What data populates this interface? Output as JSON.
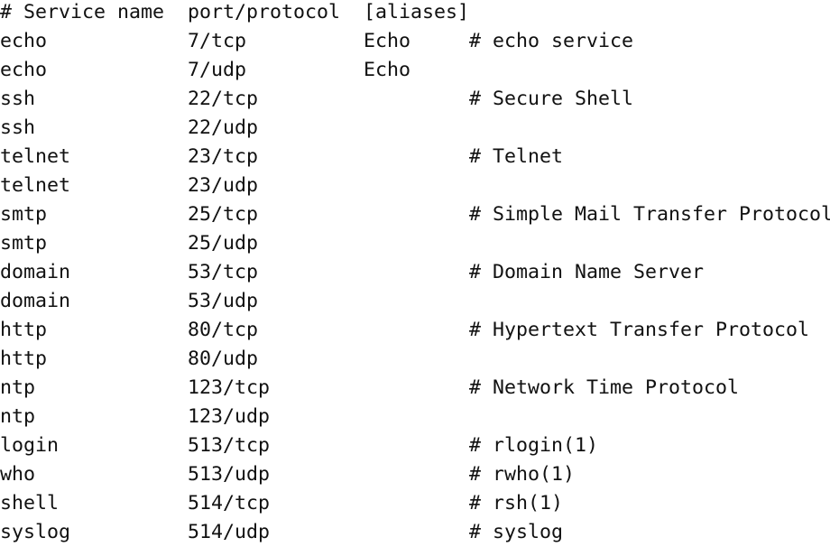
{
  "header": {
    "name": "# Service name",
    "port": "port/protocol",
    "aliases": "[aliases]",
    "comment": ""
  },
  "rows": [
    {
      "name": "echo",
      "port": "7/tcp",
      "aliases": "Echo",
      "comment": "# echo service"
    },
    {
      "name": "echo",
      "port": "7/udp",
      "aliases": "Echo",
      "comment": ""
    },
    {
      "name": "ssh",
      "port": "22/tcp",
      "aliases": "",
      "comment": "# Secure Shell"
    },
    {
      "name": "ssh",
      "port": "22/udp",
      "aliases": "",
      "comment": ""
    },
    {
      "name": "telnet",
      "port": "23/tcp",
      "aliases": "",
      "comment": "# Telnet"
    },
    {
      "name": "telnet",
      "port": "23/udp",
      "aliases": "",
      "comment": ""
    },
    {
      "name": "smtp",
      "port": "25/tcp",
      "aliases": "",
      "comment": "# Simple Mail Transfer Protocol"
    },
    {
      "name": "smtp",
      "port": "25/udp",
      "aliases": "",
      "comment": ""
    },
    {
      "name": "domain",
      "port": "53/tcp",
      "aliases": "",
      "comment": "# Domain Name Server"
    },
    {
      "name": "domain",
      "port": "53/udp",
      "aliases": "",
      "comment": ""
    },
    {
      "name": "http",
      "port": "80/tcp",
      "aliases": "",
      "comment": "# Hypertext Transfer Protocol"
    },
    {
      "name": "http",
      "port": "80/udp",
      "aliases": "",
      "comment": ""
    },
    {
      "name": "ntp",
      "port": "123/tcp",
      "aliases": "",
      "comment": "# Network Time Protocol"
    },
    {
      "name": "ntp",
      "port": "123/udp",
      "aliases": "",
      "comment": ""
    },
    {
      "name": "login",
      "port": "513/tcp",
      "aliases": "",
      "comment": "# rlogin(1)"
    },
    {
      "name": "who",
      "port": "513/udp",
      "aliases": "",
      "comment": "# rwho(1)"
    },
    {
      "name": "shell",
      "port": "514/tcp",
      "aliases": "",
      "comment": "# rsh(1)"
    },
    {
      "name": "syslog",
      "port": "514/udp",
      "aliases": "",
      "comment": "# syslog"
    }
  ]
}
